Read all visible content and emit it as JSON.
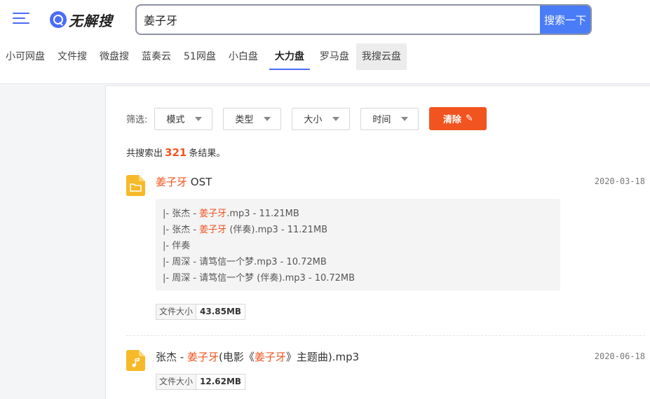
{
  "header": {
    "logo_text": "无解搜",
    "search_value": "姜子牙",
    "search_button": "搜索一下"
  },
  "tabs": [
    {
      "label": "小可网盘",
      "state": "normal"
    },
    {
      "label": "文件搜",
      "state": "normal"
    },
    {
      "label": "微盘搜",
      "state": "normal"
    },
    {
      "label": "蓝奏云",
      "state": "normal"
    },
    {
      "label": "51网盘",
      "state": "normal"
    },
    {
      "label": "小白盘",
      "state": "normal"
    },
    {
      "label": "大力盘",
      "state": "active"
    },
    {
      "label": "罗马盘",
      "state": "normal"
    },
    {
      "label": "我搜云盘",
      "state": "hover"
    }
  ],
  "filters": {
    "label": "筛选:",
    "options": [
      "模式",
      "类型",
      "大小",
      "时间"
    ],
    "clear_label": "清除"
  },
  "summary": {
    "prefix": "共搜索出",
    "count": "321",
    "suffix": "条结果。"
  },
  "results": [
    {
      "type": "folder",
      "title_parts": [
        {
          "text": "姜子牙",
          "highlight": true
        },
        {
          "text": " OST",
          "highlight": false
        }
      ],
      "date": "2020-03-18",
      "files": [
        [
          {
            "text": "|- 张杰 - ",
            "highlight": false
          },
          {
            "text": "姜子牙",
            "highlight": true
          },
          {
            "text": ".mp3 - 11.21MB",
            "highlight": false
          }
        ],
        [
          {
            "text": "|- 张杰 - ",
            "highlight": false
          },
          {
            "text": "姜子牙",
            "highlight": true
          },
          {
            "text": " (伴奏).mp3 - 11.21MB",
            "highlight": false
          }
        ],
        [
          {
            "text": "|- 伴奏",
            "highlight": false
          }
        ],
        [
          {
            "text": "|- 周深 - 请笃信一个梦.mp3 - 10.72MB",
            "highlight": false
          }
        ],
        [
          {
            "text": "|- 周深 - 请笃信一个梦 (伴奏).mp3 - 10.72MB",
            "highlight": false
          }
        ]
      ],
      "size_label": "文件大小",
      "size_value": "43.85MB"
    },
    {
      "type": "music",
      "title_parts": [
        {
          "text": "张杰 - ",
          "highlight": false
        },
        {
          "text": "姜子牙",
          "highlight": true
        },
        {
          "text": "(电影《",
          "highlight": false
        },
        {
          "text": "姜子牙",
          "highlight": true
        },
        {
          "text": "》主题曲).mp3",
          "highlight": false
        }
      ],
      "date": "2020-06-18",
      "files": [],
      "size_label": "文件大小",
      "size_value": "12.62MB"
    }
  ],
  "colors": {
    "accent": "#4a6cf7",
    "highlight": "#f2541f",
    "file_icon": "#f7b928"
  },
  "icons": [
    "menu-icon",
    "search-logo-icon",
    "caret-down-icon",
    "broom-icon",
    "folder-icon",
    "music-file-icon"
  ]
}
